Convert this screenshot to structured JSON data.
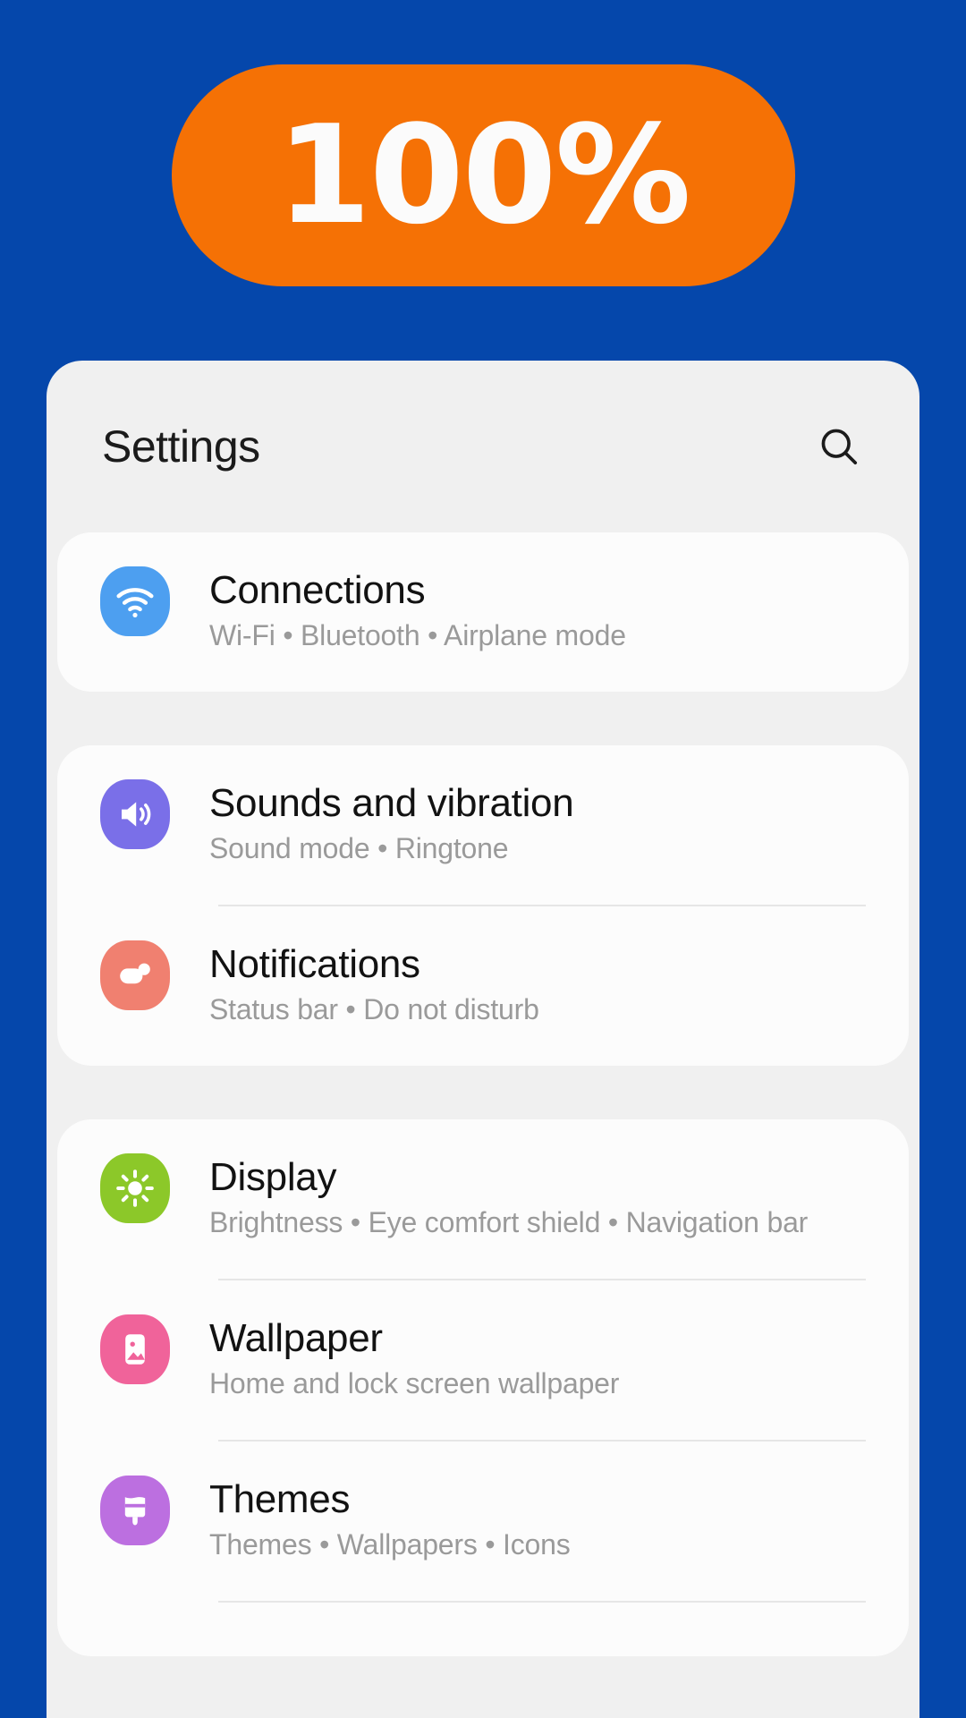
{
  "badge": {
    "value": "100%",
    "bg_color": "#F57105",
    "text_color": "#FBFBFB"
  },
  "background_color": "#0547AB",
  "panel": {
    "background_color": "#F0F0F0",
    "header": {
      "title": "Settings",
      "search_icon": "search-icon"
    },
    "groups": [
      {
        "rows": [
          {
            "icon": "wifi-icon",
            "icon_color": "#4D9FF0",
            "title": "Connections",
            "subtitle": "Wi-Fi  •  Bluetooth  •  Airplane mode"
          }
        ]
      },
      {
        "rows": [
          {
            "icon": "speaker-icon",
            "icon_color": "#7A6FE8",
            "title": "Sounds and vibration",
            "subtitle": "Sound mode  •  Ringtone"
          },
          {
            "icon": "notification-icon",
            "icon_color": "#F08070",
            "title": "Notifications",
            "subtitle": "Status bar  •  Do not disturb"
          }
        ]
      },
      {
        "rows": [
          {
            "icon": "brightness-sun-icon",
            "icon_color": "#8CC829",
            "title": "Display",
            "subtitle": "Brightness  •  Eye comfort shield  •  Navigation bar"
          },
          {
            "icon": "image-icon",
            "icon_color": "#F0639A",
            "title": "Wallpaper",
            "subtitle": "Home and lock screen wallpaper"
          },
          {
            "icon": "paintbrush-icon",
            "icon_color": "#BC6FE0",
            "title": "Themes",
            "subtitle": "Themes  •  Wallpapers  •  Icons"
          }
        ]
      }
    ]
  }
}
